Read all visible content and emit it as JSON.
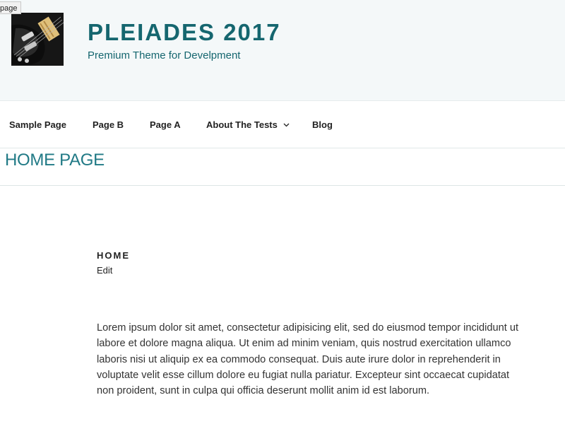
{
  "skip_link": {
    "label": "page"
  },
  "header": {
    "site_title": "PLEIADES 2017",
    "tagline": "Premium Theme for Develpment",
    "logo_icon": "guitar-photo",
    "background": "#f4f8f9",
    "title_color": "#15666f"
  },
  "nav": {
    "items": [
      {
        "label": "Sample Page"
      },
      {
        "label": "Page B"
      },
      {
        "label": "Page A"
      },
      {
        "label": "About The Tests",
        "icon": "chevron-down-icon"
      },
      {
        "label": "Blog"
      }
    ]
  },
  "page_heading": "HOME PAGE",
  "entry": {
    "title": "HOME",
    "edit_label": "Edit",
    "content": "Lorem ipsum dolor sit amet, consectetur adipisicing elit, sed do eiusmod tempor incididunt ut labore et dolore magna aliqua. Ut enim ad minim veniam, quis nostrud exercitation ullamco laboris nisi ut aliquip ex ea commodo consequat. Duis aute irure dolor in reprehenderit in voluptate velit esse cillum dolore eu fugiat nulla pariatur. Excepteur sint occaecat cupidatat non proident, sunt in culpa qui officia deserunt mollit anim id est laborum."
  },
  "colors": {
    "accent": "#217a86",
    "text": "#333333"
  }
}
